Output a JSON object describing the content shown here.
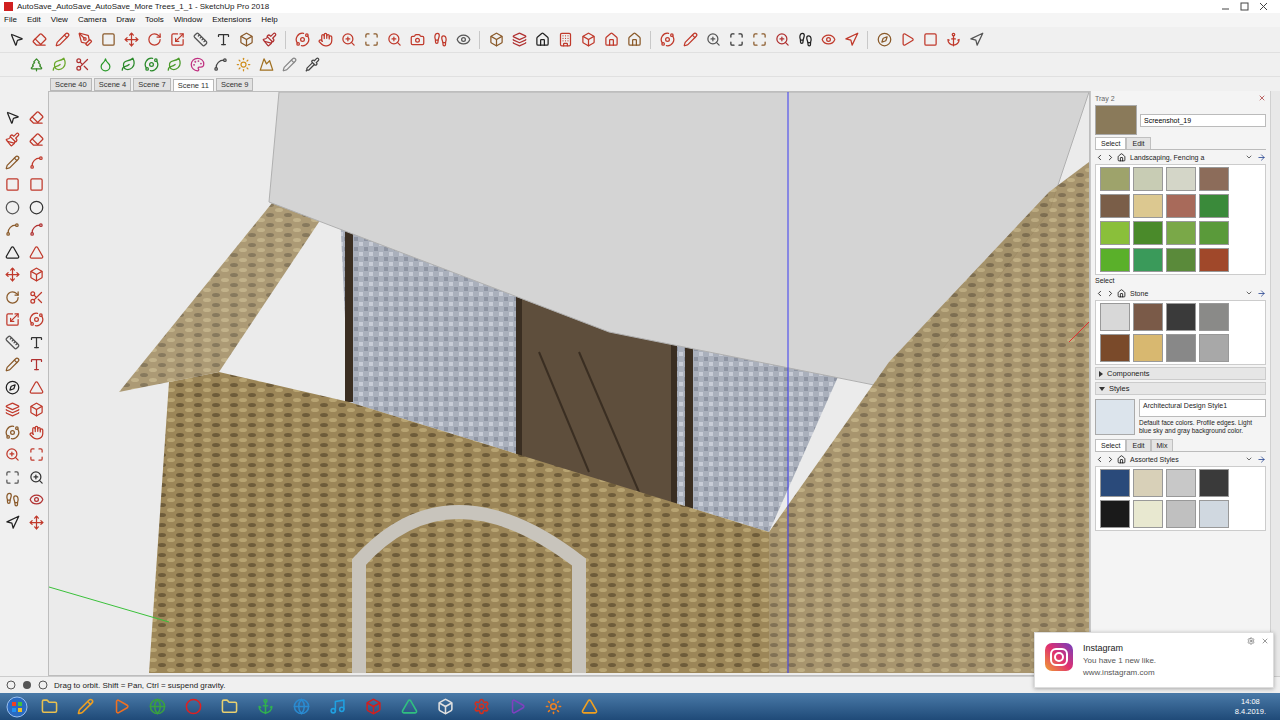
{
  "window": {
    "title": "AutoSave_AutoSave_AutoSave_More Trees_1_1 - SketchUp Pro 2018"
  },
  "menu": [
    "File",
    "Edit",
    "View",
    "Camera",
    "Draw",
    "Tools",
    "Window",
    "Extensions",
    "Help"
  ],
  "scenes": [
    {
      "label": "Scene 40",
      "selected": false
    },
    {
      "label": "Scene 4",
      "selected": false
    },
    {
      "label": "Scene 7",
      "selected": false
    },
    {
      "label": "Scene 11",
      "selected": true
    },
    {
      "label": "Scene 9",
      "selected": false
    }
  ],
  "tray": {
    "title": "Tray 2",
    "materials": {
      "current": "Screenshot_19",
      "tabs": [
        {
          "label": "Select",
          "selected": true
        },
        {
          "label": "Edit",
          "selected": false
        }
      ],
      "library": "Landscaping, Fencing a",
      "swatches": [
        {
          "color": "#9ea36b"
        },
        {
          "color": "#c8ccb4"
        },
        {
          "color": "#d4d6c8"
        },
        {
          "color": "#8c6c5a"
        },
        {
          "color": "#7a5e48"
        },
        {
          "color": "#dcc890"
        },
        {
          "color": "#a86a5a"
        },
        {
          "color": "#3a8a3a"
        },
        {
          "color": "#8abf3a"
        },
        {
          "color": "#4a8a2a"
        },
        {
          "color": "#7aa848"
        },
        {
          "color": "#5a9a3a"
        },
        {
          "color": "#5ab02a"
        },
        {
          "color": "#3a9a5a"
        },
        {
          "color": "#5a8a3a"
        },
        {
          "color": "#a0482a"
        }
      ],
      "select_label": "Select",
      "library2": "Stone",
      "swatches2": [
        {
          "color": "#d8d8d8"
        },
        {
          "color": "#7a5a48"
        },
        {
          "color": "#3a3a3a"
        },
        {
          "color": "#8a8a88"
        },
        {
          "color": "#7a4a2a"
        },
        {
          "color": "#d8b870"
        },
        {
          "color": "#888888"
        },
        {
          "color": "#a8a8a8"
        }
      ]
    },
    "sections": [
      {
        "label": "Components",
        "expanded": false
      },
      {
        "label": "Styles",
        "expanded": true
      }
    ],
    "styles": {
      "name": "Architectural Design Style1",
      "description": "Default face colors. Profile edges. Light blue sky and gray background color.",
      "tabs": [
        {
          "label": "Select",
          "selected": true
        },
        {
          "label": "Edit",
          "selected": false
        },
        {
          "label": "Mix",
          "selected": false
        }
      ],
      "library": "Assorted Styles",
      "thumbnails": [
        {
          "color": "#2a4a7a"
        },
        {
          "color": "#d8d0b8"
        },
        {
          "color": "#c8c8c8"
        },
        {
          "color": "#3a3a3a"
        },
        {
          "color": "#1a1a1a"
        },
        {
          "color": "#e8e8d0"
        },
        {
          "color": "#c0c0c0"
        },
        {
          "color": "#d0d8e0"
        }
      ]
    }
  },
  "notification": {
    "app": "Instagram",
    "message": "You have 1 new like.",
    "url": "www.instagram.com"
  },
  "status_bar": {
    "hint": "Drag to orbit. Shift = Pan, Ctrl = suspend gravity."
  },
  "taskbar": {
    "time": "14:08",
    "date": "8.4.2019."
  }
}
